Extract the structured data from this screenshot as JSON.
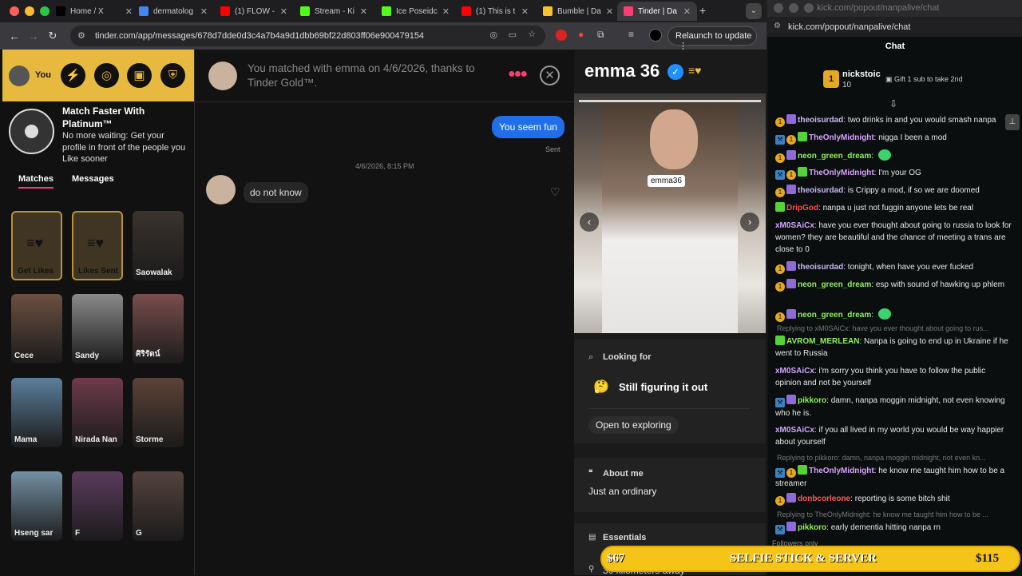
{
  "browser": {
    "tabs": [
      {
        "label": "Home / X",
        "color": "#000000"
      },
      {
        "label": "dermatolog",
        "color": "#4285f4"
      },
      {
        "label": "(1) FLOW -",
        "color": "#ff0000"
      },
      {
        "label": "Stream - Ki",
        "color": "#53fc18"
      },
      {
        "label": "Ice Poseidc",
        "color": "#53fc18"
      },
      {
        "label": "(1) This is t",
        "color": "#ff0000"
      },
      {
        "label": "Bumble | Da",
        "color": "#f6c228"
      },
      {
        "label": "Tinder | Da",
        "color": "#fe3c72"
      }
    ],
    "url": "tinder.com/app/messages/678d7dde0d3c4a7b4a9d1dbb69bf22d803ff06e900479154",
    "relaunch": "Relaunch to update"
  },
  "tinder": {
    "you_label": "You",
    "promo_title": "Match Faster With Platinum™",
    "promo_text": "No more waiting: Get your profile in front of the people you Like sooner",
    "tabs": [
      "Matches",
      "Messages"
    ],
    "grid": [
      {
        "label": "Get Likes",
        "gold": true
      },
      {
        "label": "Likes Sent",
        "gold": true
      },
      {
        "label": "Saowalak",
        "color": "#3a332e"
      },
      {
        "label": "Cece",
        "color": "#6b5040"
      },
      {
        "label": "Sandy",
        "color": "#8a8a8a"
      },
      {
        "label": "ศิริรัตน์",
        "color": "#7a4d4d"
      },
      {
        "label": "Mama",
        "color": "#5b7f9c"
      },
      {
        "label": "Nirada Nan",
        "color": "#6e3b4b"
      },
      {
        "label": "Storme",
        "color": "#5c4338"
      },
      {
        "label": "Hseng sar",
        "color": "#7390a4"
      },
      {
        "label": "F",
        "color": "#5a3b5c"
      },
      {
        "label": "G",
        "color": "#54433f"
      }
    ],
    "match_text": "You matched with emma on 4/6/2026, thanks to Tinder Gold™.",
    "messages": {
      "sent": "You seem fun",
      "sent_status": "Sent",
      "timestamp": "4/6/2026, 8:15 PM",
      "received": "do not know"
    },
    "profile": {
      "name": "emma",
      "age": "36",
      "photo_caption": "emma36",
      "looking_for_label": "Looking for",
      "looking_for_value": "Still figuring it out",
      "looking_for_emoji": "🤔",
      "open_to": "Open to exploring",
      "about_label": "About me",
      "about_text": "Just an ordinary",
      "essentials_label": "Essentials",
      "distance": "30 kilometers away"
    }
  },
  "kick": {
    "window_title": "kick.com/popout/nanpalive/chat",
    "url": "kick.com/popout/nanpalive/chat",
    "header": "Chat",
    "pinned_user": "nickstoic",
    "pinned_count": "10",
    "pinned_gift": "Gift 1 sub to take 2nd",
    "messages": [
      {
        "user": "theoisurdad",
        "color": "#c9b6f2",
        "badges": [
          "b1",
          "b2"
        ],
        "text": "two drinks in and you would smash nanpa"
      },
      {
        "user": "TheOnlyMidnight",
        "color": "#d8a2ff",
        "badges": [
          "b3",
          "b1",
          "b4"
        ],
        "text": "nigga I been a mod"
      },
      {
        "user": "neon_green_dream",
        "color": "#8ef25a",
        "badges": [
          "b1",
          "b2"
        ],
        "text": ""
      },
      {
        "user": "TheOnlyMidnight",
        "color": "#d8a2ff",
        "badges": [
          "b3",
          "b1",
          "b4"
        ],
        "text": "I'm your OG"
      },
      {
        "user": "theoisurdad",
        "color": "#c9b6f2",
        "badges": [
          "b1",
          "b2"
        ],
        "text": "is Crippy a mod, if so we are doomed"
      },
      {
        "user": "DripGod",
        "color": "#ff4b4b",
        "badges": [
          "b4"
        ],
        "text": "nanpa u just not fuggin anyone lets be real"
      },
      {
        "user": "xM0SAiCx",
        "color": "#d0a6ff",
        "badges": [],
        "text": "have you ever thought about going to russia to look for women? they are beautiful and the chance of meeting a trans are close to 0"
      },
      {
        "user": "theoisurdad",
        "color": "#c9b6f2",
        "badges": [
          "b1",
          "b2"
        ],
        "text": "tonight, when have you ever fucked"
      },
      {
        "user": "neon_green_dream",
        "color": "#8ef25a",
        "badges": [
          "b1",
          "b2"
        ],
        "text": "esp with sound of hawking up phlem"
      },
      {
        "user": "neon_green_dream",
        "color": "#8ef25a",
        "badges": [
          "b1",
          "b2"
        ],
        "text": ""
      },
      {
        "user": "AVROM_MERLEAN",
        "color": "#8ef25a",
        "badges": [
          "b4"
        ],
        "reply": "Replying to xM0SAiCx: have you ever thought about going to rus...",
        "text": "Nanpa is going to end up in Ukraine if he went to Russia"
      },
      {
        "user": "xM0SAiCx",
        "color": "#d0a6ff",
        "badges": [],
        "text": "i'm sorry you think you have to follow the public opinion and not be yourself"
      },
      {
        "user": "pikkoro",
        "color": "#8ef25a",
        "badges": [
          "b3",
          "b2"
        ],
        "text": "damn, nanpa moggin midnight, not even knowing who he is."
      },
      {
        "user": "xM0SAiCx",
        "color": "#d0a6ff",
        "badges": [],
        "text": "if you all lived in my world you would be way happier about yourself"
      },
      {
        "user": "TheOnlyMidnight",
        "color": "#d8a2ff",
        "badges": [
          "b3",
          "b1",
          "b4"
        ],
        "reply": "Replying to pikkoro: damn, nanpa moggin midnight, not even kn...",
        "text": "he know me taught him how to be a streamer"
      },
      {
        "user": "donbcorleone",
        "color": "#ff5a5a",
        "badges": [
          "b1",
          "b2"
        ],
        "text": "reporting is some bitch shit"
      },
      {
        "user": "pikkoro",
        "color": "#8ef25a",
        "badges": [
          "b3",
          "b2"
        ],
        "reply": "Replying to TheOnlyMidnight: he know me taught him how to be ...",
        "text": "early dementia hitting nanpa rn"
      }
    ],
    "followers_only": "Followers only"
  },
  "overlay": {
    "left_price": "$67",
    "title": "SELFIE STICK & SERVER",
    "right_price": "$115"
  }
}
